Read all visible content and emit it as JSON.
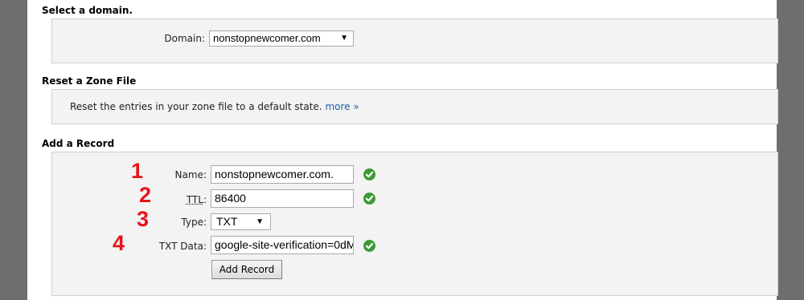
{
  "select_domain": {
    "heading": "Select a domain.",
    "label": "Domain:",
    "selected": "nonstopnewcomer.com"
  },
  "reset_zone": {
    "heading": "Reset a Zone File",
    "text": "Reset the entries in your zone file to a default state.",
    "more_link": "more »"
  },
  "add_record": {
    "heading": "Add a Record",
    "fields": [
      {
        "number": "1",
        "label": "Name:",
        "value": "nonstopnewcomer.com."
      },
      {
        "number": "2",
        "label": "TTL",
        "label_suffix": ":",
        "value": "86400"
      },
      {
        "number": "3",
        "label": "Type:",
        "value": "TXT"
      },
      {
        "number": "4",
        "label": "TXT Data:",
        "value": "google-site-verification=0dM"
      }
    ],
    "button": "Add Record"
  },
  "colors": {
    "annotation_numbers": "#e8141b",
    "check_icon": "#3d9b35",
    "link": "#1f5fa6"
  }
}
